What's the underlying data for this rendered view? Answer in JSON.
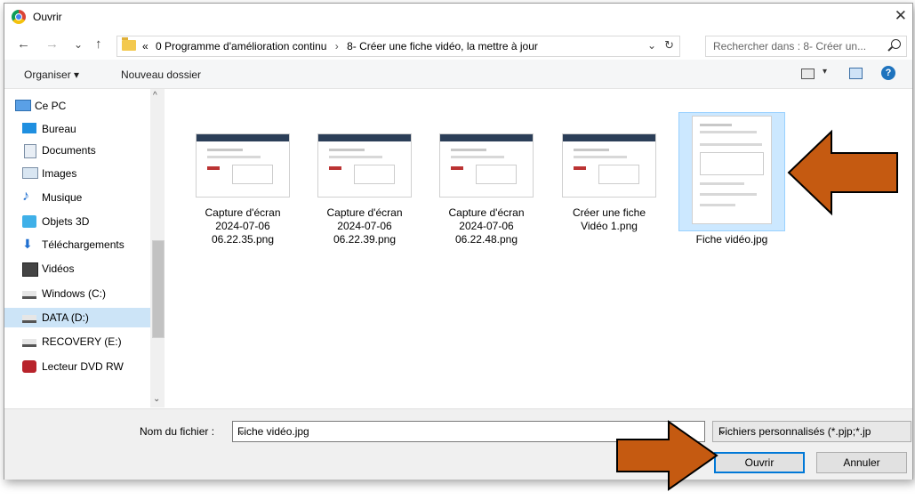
{
  "window": {
    "title": "Ouvrir",
    "icon": "chrome-icon",
    "close_glyph": "✕"
  },
  "address": {
    "back": "←",
    "forward": "→",
    "recent": "⌄",
    "up": "↑",
    "prefix": "«",
    "crumbs": [
      "0 Programme d'amélioration continu",
      "8- Créer une fiche vidéo, la mettre à jour"
    ],
    "separator": "›",
    "dropdown": "⌄",
    "refresh": "↻"
  },
  "search": {
    "placeholder": "Rechercher dans : 8- Créer un..."
  },
  "toolbar": {
    "organize": "Organiser ▾",
    "new_folder": "Nouveau dossier",
    "view_dropdown": "▾",
    "help": "?"
  },
  "nav": {
    "items": [
      {
        "label": "Ce PC",
        "icon": "computer-icon"
      },
      {
        "label": "Bureau",
        "icon": "desktop-icon"
      },
      {
        "label": "Documents",
        "icon": "documents-icon"
      },
      {
        "label": "Images",
        "icon": "pictures-icon"
      },
      {
        "label": "Musique",
        "icon": "music-icon"
      },
      {
        "label": "Objets 3D",
        "icon": "cube-icon"
      },
      {
        "label": "Téléchargements",
        "icon": "download-icon"
      },
      {
        "label": "Vidéos",
        "icon": "video-icon"
      },
      {
        "label": "Windows (C:)",
        "icon": "drive-icon"
      },
      {
        "label": "DATA (D:)",
        "icon": "drive-icon"
      },
      {
        "label": "RECOVERY (E:)",
        "icon": "drive-icon"
      },
      {
        "label": "Lecteur DVD RW",
        "icon": "dvd-icon"
      }
    ],
    "selected": "DATA (D:)",
    "scroll_up": "^",
    "scroll_down": "⌄"
  },
  "files": [
    {
      "name": "Capture d'écran 2024-07-06 06.22.35.png"
    },
    {
      "name": "Capture d'écran 2024-07-06 06.22.39.png"
    },
    {
      "name": "Capture d'écran 2024-07-06 06.22.48.png"
    },
    {
      "name": "Créer une fiche Vidéo 1.png"
    },
    {
      "name": "Fiche vidéo.jpg"
    }
  ],
  "selected_file": "Fiche vidéo.jpg",
  "bottom": {
    "filename_label": "Nom du fichier :",
    "filename_value": "Fiche vidéo.jpg",
    "filename_dropdown": "⌄",
    "filter": "Fichiers personnalisés (*.pjp;*.jp",
    "filter_dropdown": "⌄",
    "open": "Ouvrir",
    "cancel": "Annuler"
  },
  "colors": {
    "arrow_fill": "#c55a11",
    "arrow_stroke": "#000000",
    "selection": "#cce8ff",
    "primary_border": "#0078d7"
  }
}
